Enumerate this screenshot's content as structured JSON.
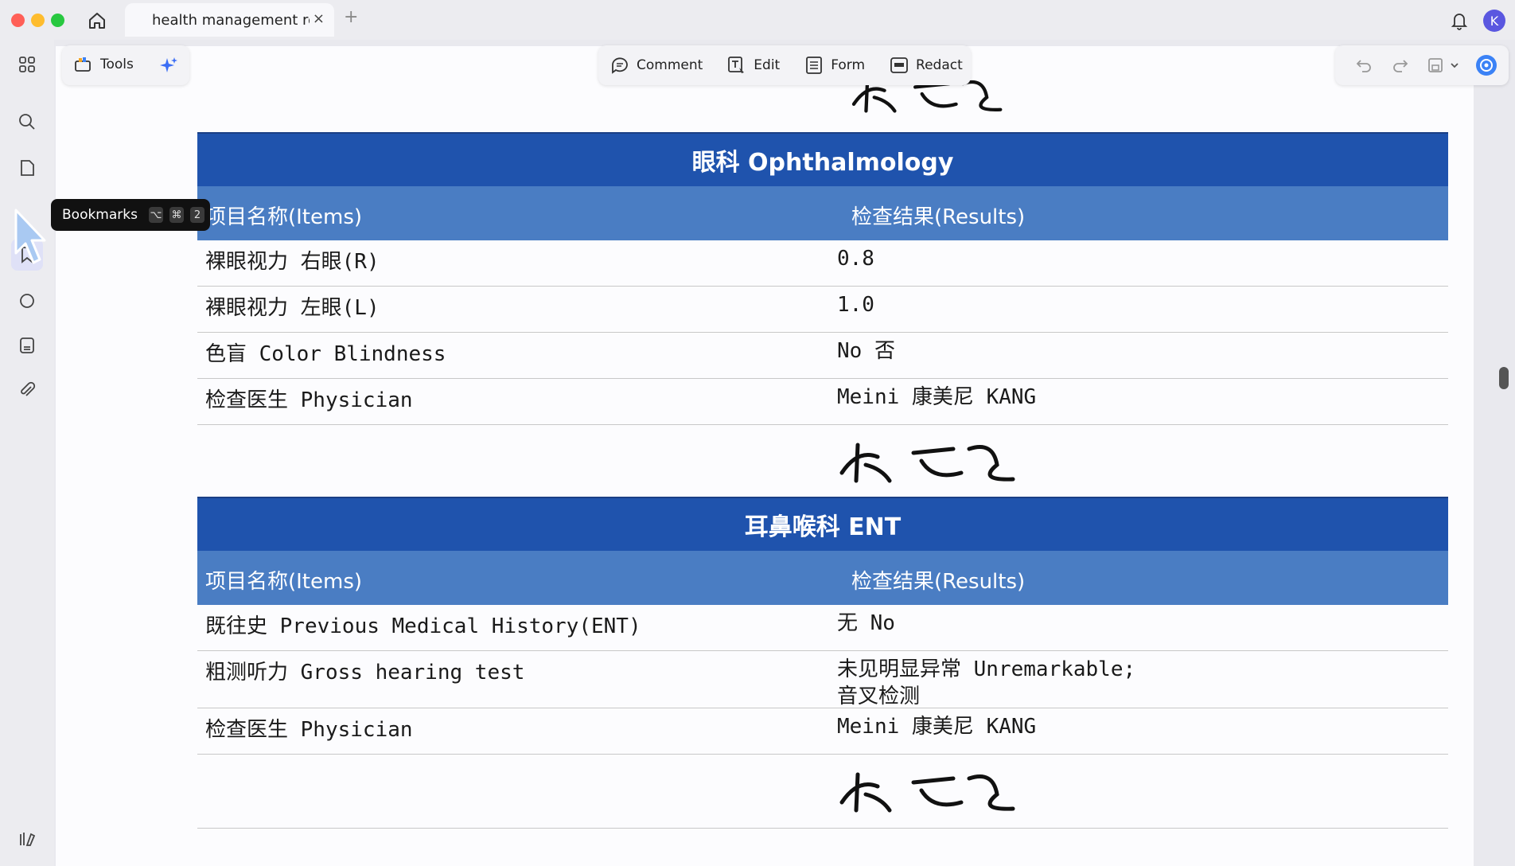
{
  "window": {
    "tab_title": "health management repo",
    "tab_close": "×",
    "tab_add": "+",
    "avatar_initial": "K",
    "traffic_lights": [
      "#ff5f57",
      "#febc2e",
      "#28c840"
    ]
  },
  "toolbar": {
    "tools_label": "Tools",
    "comment_label": "Comment",
    "edit_label": "Edit",
    "form_label": "Form",
    "redact_label": "Redact"
  },
  "tooltip": {
    "label": "Bookmarks",
    "keys": [
      "⌥",
      "⌘",
      "2"
    ]
  },
  "left_rail": {
    "icons": [
      "grid-icon",
      "search-icon",
      "page-icon",
      "bookmark-icon",
      "stamp-icon",
      "document-icon",
      "attachment-icon",
      "library-icon"
    ]
  },
  "document": {
    "ophthalmology": {
      "title": "眼科 Ophthalmology",
      "col_items": "项目名称(Items)",
      "col_results": "检查结果(Results)",
      "rows": [
        {
          "item": "裸眼视力 右眼(R)",
          "result": "0.8"
        },
        {
          "item": "裸眼视力 左眼(L)",
          "result": "1.0"
        },
        {
          "item": "色盲 Color Blindness",
          "result": "No 否"
        },
        {
          "item": "检查医生 Physician",
          "result": "Meini 康美尼 KANG"
        }
      ]
    },
    "ent": {
      "title": "耳鼻喉科 ENT",
      "col_items": "项目名称(Items)",
      "col_results": "检查结果(Results)",
      "rows": [
        {
          "item": "既往史 Previous Medical History(ENT)",
          "result": "无 No"
        },
        {
          "item": "粗测听力 Gross hearing test",
          "result": "未见明显异常 Unremarkable;",
          "result_line2": "音叉检测"
        },
        {
          "item": "检查医生 Physician",
          "result": "Meini 康美尼 KANG"
        }
      ]
    },
    "signature_text": "康美尼"
  },
  "colors": {
    "section_header": "#1f53ad",
    "column_header": "#4a7dc3",
    "accent": "#5a57e0"
  }
}
